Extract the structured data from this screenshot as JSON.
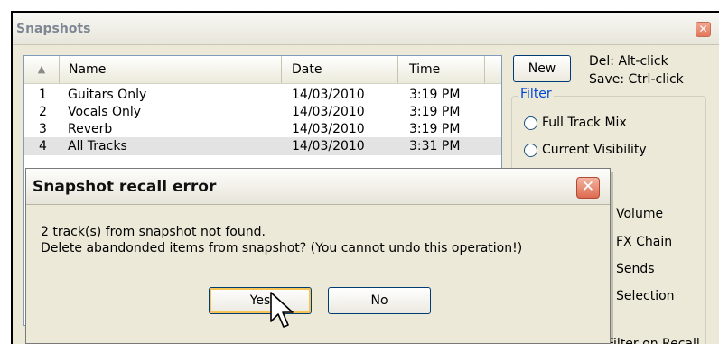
{
  "snapshots_window": {
    "title": "Snapshots",
    "close_symbol": "✕",
    "list": {
      "sort_symbol": "▲",
      "columns": [
        "Name",
        "Date",
        "Time"
      ],
      "rows": [
        {
          "num": "1",
          "name": "Guitars Only",
          "date": "14/03/2010",
          "time": "3:19 PM"
        },
        {
          "num": "2",
          "name": "Vocals Only",
          "date": "14/03/2010",
          "time": "3:19 PM"
        },
        {
          "num": "3",
          "name": "Reverb",
          "date": "14/03/2010",
          "time": "3:19 PM"
        },
        {
          "num": "4",
          "name": "All Tracks",
          "date": "14/03/2010",
          "time": "3:31 PM"
        }
      ],
      "selected_row": 4
    },
    "new_button": "New",
    "hint_delete": "Del: Alt-click",
    "hint_save": "Save: Ctrl-click",
    "filter": {
      "label": "Filter",
      "radios": [
        "Full Track Mix",
        "Current Visibility"
      ],
      "options": [
        "Volume",
        "FX Chain",
        "Sends",
        "Selection"
      ],
      "recall_checkbox": "Filter on Recall"
    }
  },
  "error_dialog": {
    "title": "Snapshot recall error",
    "close_symbol": "✕",
    "message_line1": "2 track(s) from snapshot not found.",
    "message_line2": "Delete abandonded items from snapshot?  (You cannot undo this operation!)",
    "yes_button": "Yes",
    "no_button": "No"
  },
  "colors": {
    "window_bg": "#ece9d8",
    "filter_label": "#0046d5",
    "button_border": "#003c74",
    "default_button_glow": "#f5c454"
  }
}
